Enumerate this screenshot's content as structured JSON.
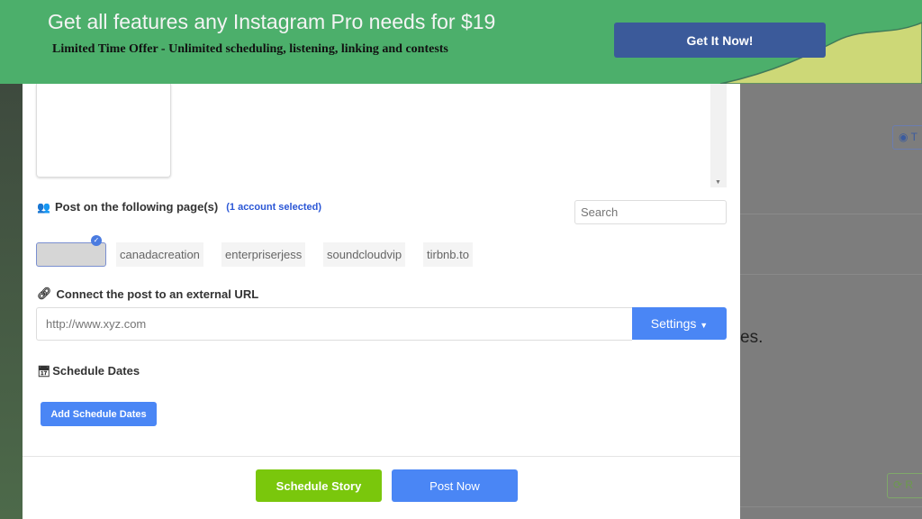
{
  "banner": {
    "title": "Get all features any Instagram Pro needs for $19",
    "subtitle": "Limited Time Offer - Unlimited scheduling, listening, linking and contests",
    "cta": "Get It Now!",
    "colors": {
      "bg": "#4caf6b",
      "cta": "#3b5a9a",
      "wave": "#cdd877"
    }
  },
  "background": {
    "text_fragment": "es.",
    "button_top_label": "T",
    "button_bottom_label": "R"
  },
  "modal": {
    "pages_label": "Post on the following page(s)",
    "selected_count": "(1 account selected)",
    "search_placeholder": "Search",
    "accounts": [
      {
        "name": "",
        "selected": true
      },
      {
        "name": "canadacreation"
      },
      {
        "name": "enterpriserjess"
      },
      {
        "name": "soundcloudvip"
      },
      {
        "name": "tirbnb.to"
      }
    ],
    "url_label": "Connect the post to an external URL",
    "url_placeholder": "http://www.xyz.com",
    "settings_label": "Settings",
    "schedule_label": "Schedule Dates",
    "add_schedule_label": "Add Schedule Dates",
    "schedule_story_label": "Schedule Story",
    "post_now_label": "Post Now",
    "colors": {
      "primary": "#4a86f5",
      "story": "#7ac70c"
    }
  }
}
